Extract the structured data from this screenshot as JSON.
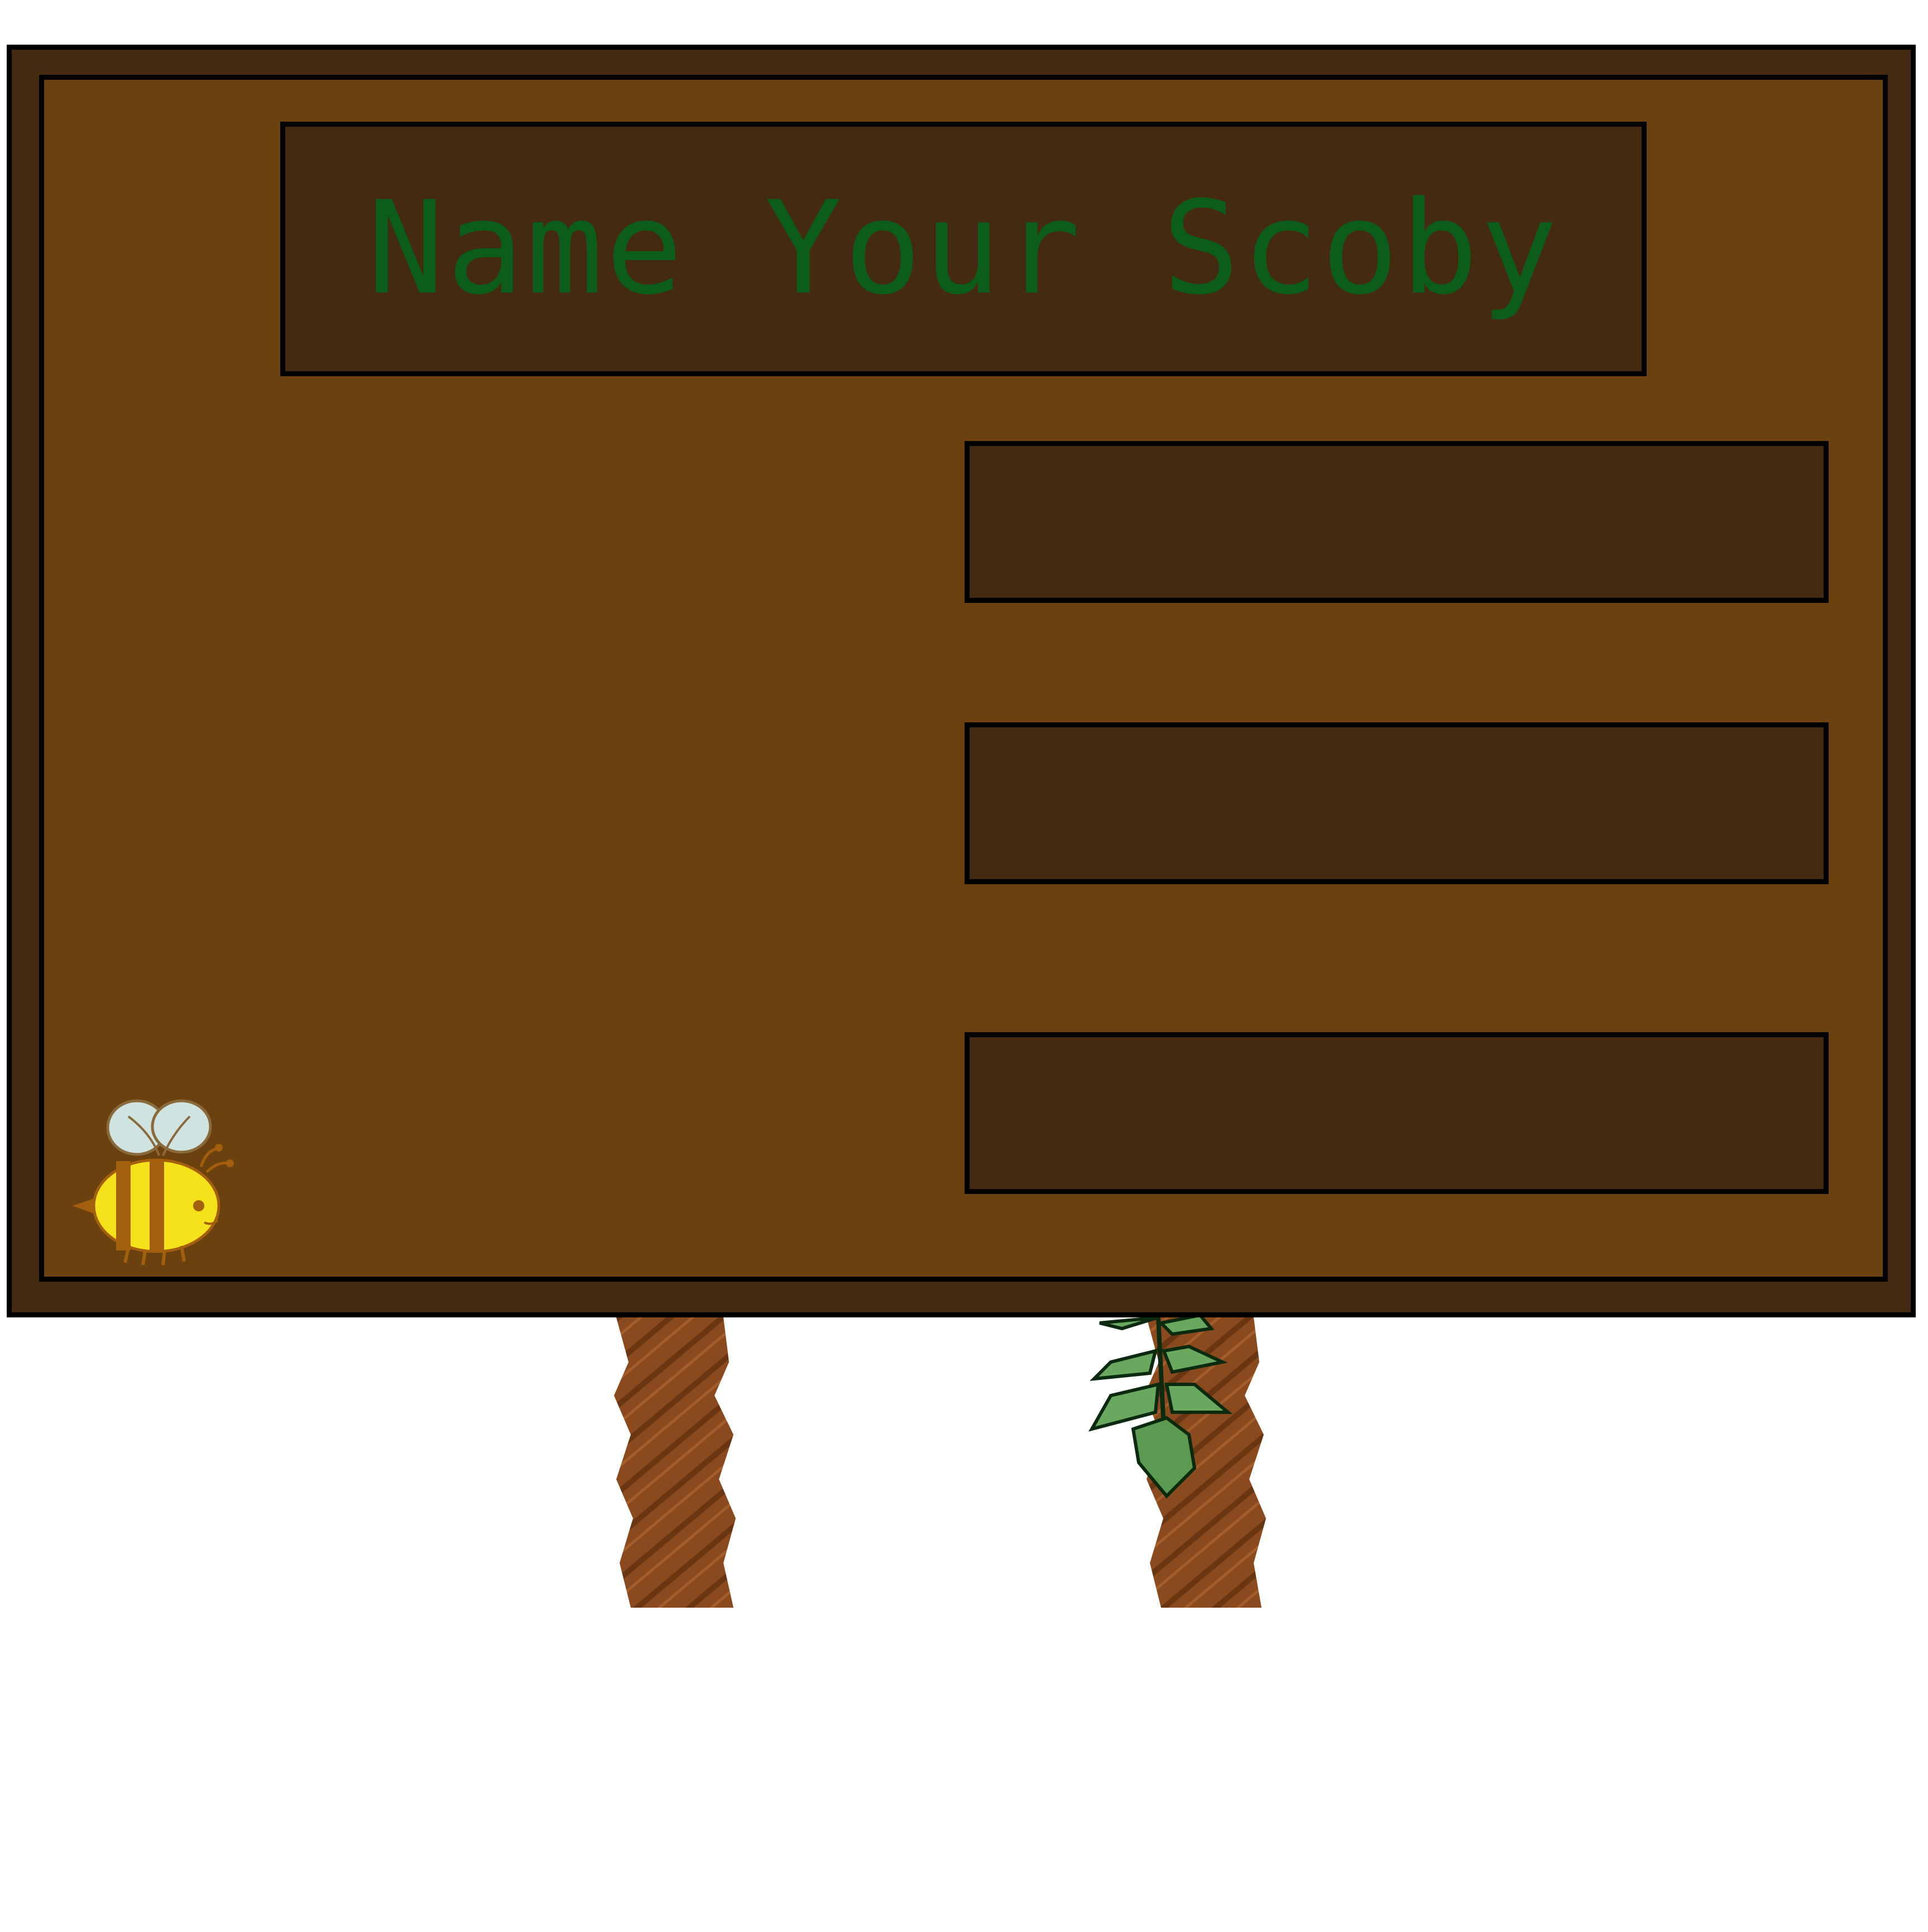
{
  "scene": {
    "title": "Name Your Scoby",
    "name_options": [
      "",
      "",
      ""
    ]
  },
  "colors": {
    "frame_dark": "#432a10",
    "board_brown": "#6b410f",
    "title_green": "#0c5c1a",
    "rope_brown": "#8a4a1e",
    "leaf_green": "#6aa860",
    "bee_yellow": "#f5e21a",
    "bee_stripe": "#a35f0c",
    "bee_wing": "#cfe3e1"
  },
  "icons": {
    "bee": "bee-icon",
    "rope_post": "rope-post-icon",
    "leaf_vine": "leaf-vine-icon"
  }
}
